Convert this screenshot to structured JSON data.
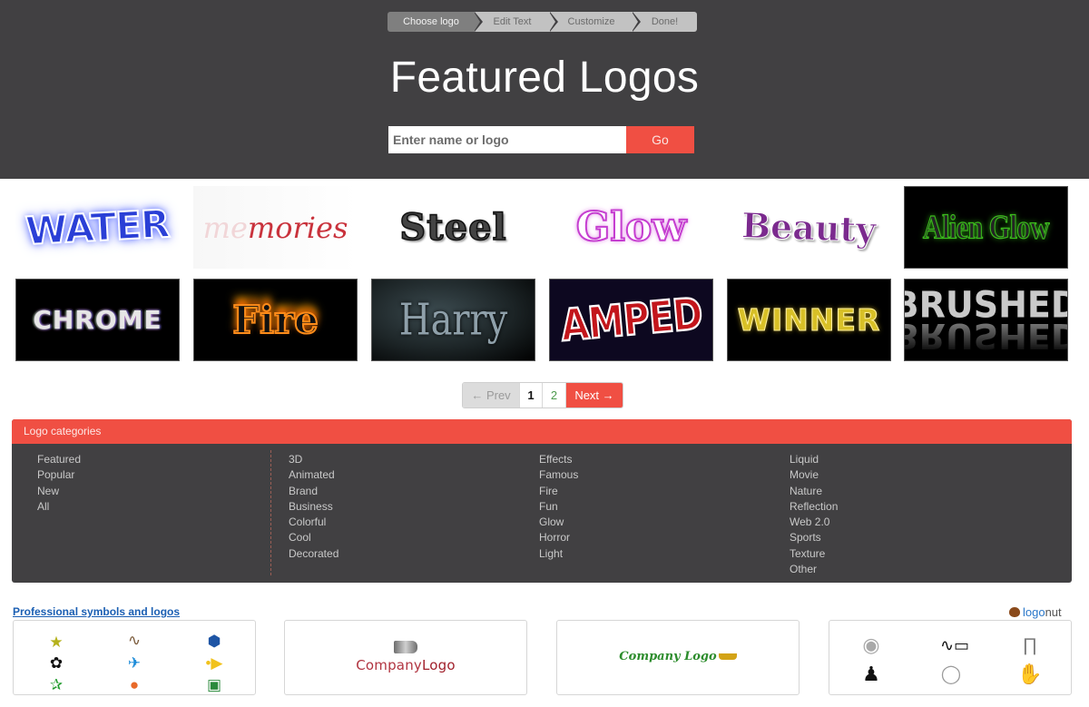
{
  "wizard": {
    "steps": [
      {
        "label": "Choose logo",
        "active": true
      },
      {
        "label": "Edit Text",
        "active": false
      },
      {
        "label": "Customize",
        "active": false
      },
      {
        "label": "Done!",
        "active": false
      }
    ]
  },
  "header": {
    "title": "Featured Logos",
    "search_placeholder": "Enter name or logo",
    "search_value": "",
    "go_label": "Go"
  },
  "logos": [
    {
      "name": "Water",
      "text": "WATER"
    },
    {
      "name": "Memories",
      "text_faded": "me",
      "text": "mories"
    },
    {
      "name": "Steel",
      "text": "Steel"
    },
    {
      "name": "Glow",
      "text": "Glow"
    },
    {
      "name": "Beauty",
      "text": "Beauty"
    },
    {
      "name": "Alien Glow",
      "text": "Alien Glow"
    },
    {
      "name": "Chrome",
      "text": "CHROME"
    },
    {
      "name": "Fire",
      "text": "Fire"
    },
    {
      "name": "Harry",
      "text": "Harry"
    },
    {
      "name": "Amped",
      "text": "AMPED"
    },
    {
      "name": "Winner",
      "text": "WINNER"
    },
    {
      "name": "Brushed",
      "text": "BRUSHED"
    }
  ],
  "pagination": {
    "prev_label": "Prev",
    "prev_icon": "arrow-left-icon",
    "pages": [
      "1",
      "2"
    ],
    "current_page": "1",
    "next_label": "Next",
    "next_icon": "arrow-right-icon"
  },
  "categories": {
    "heading": "Logo categories",
    "columns": [
      [
        "Featured",
        "Popular",
        "New",
        "All"
      ],
      [
        "3D",
        "Animated",
        "Brand",
        "Business",
        "Colorful",
        "Cool",
        "Decorated"
      ],
      [
        "Effects",
        "Famous",
        "Fire",
        "Fun",
        "Glow",
        "Horror",
        "Light"
      ],
      [
        "Liquid",
        "Movie",
        "Nature",
        "Reflection",
        "Web 2.0",
        "Sports",
        "Texture",
        "Other"
      ]
    ]
  },
  "professional": {
    "link_label": "Professional symbols and logos",
    "brand": {
      "part1": "logo",
      "part2": "nut"
    },
    "cards": [
      {
        "type": "symbols",
        "icons": [
          "star-icon",
          "swoosh-icon",
          "hexagon-icon",
          "panda-icon",
          "airplane-icon",
          "play-button-icon",
          "dancer-icon",
          "colorful-ball-icon",
          "cards-icon"
        ]
      },
      {
        "type": "company-logo",
        "text1": "Company",
        "text2": "Logo",
        "icon": "tube-icon"
      },
      {
        "type": "company-logo-script",
        "text": "Company Logo",
        "icon": "crown-icon"
      },
      {
        "type": "symbols",
        "icons": [
          "cd-icon",
          "computer-mouse-icon",
          "pillar-gate-icon",
          "hiker-icon",
          "chain-circle-icon",
          "hand-print-icon"
        ]
      }
    ]
  }
}
